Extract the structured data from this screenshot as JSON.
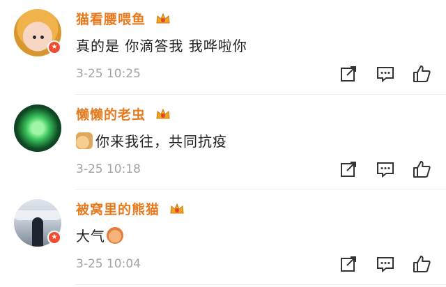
{
  "comments": [
    {
      "username": "猫看腰喂鱼",
      "text": "真的是 你滴答我 我哗啦你",
      "time": "3-25 10:25",
      "has_badge": true
    },
    {
      "username": "懒懒的老虫",
      "text": "你来我往，共同抗疫",
      "emoji": "thumbs-up-emoji",
      "time": "3-25 10:18",
      "has_badge": false
    },
    {
      "username": "被窝里的熊猫",
      "text": "大气",
      "emoji": "hands-emoji",
      "time": "3-25 10:04",
      "has_badge": true
    }
  ],
  "icons": {
    "share": "share-icon",
    "reply": "comment-icon",
    "like": "thumbs-up-icon",
    "vip": "crown-icon",
    "badge": "star-badge-icon"
  },
  "colors": {
    "username": "#e87a1d",
    "timestamp": "#a3a3a3",
    "badge": "#f04b33"
  }
}
